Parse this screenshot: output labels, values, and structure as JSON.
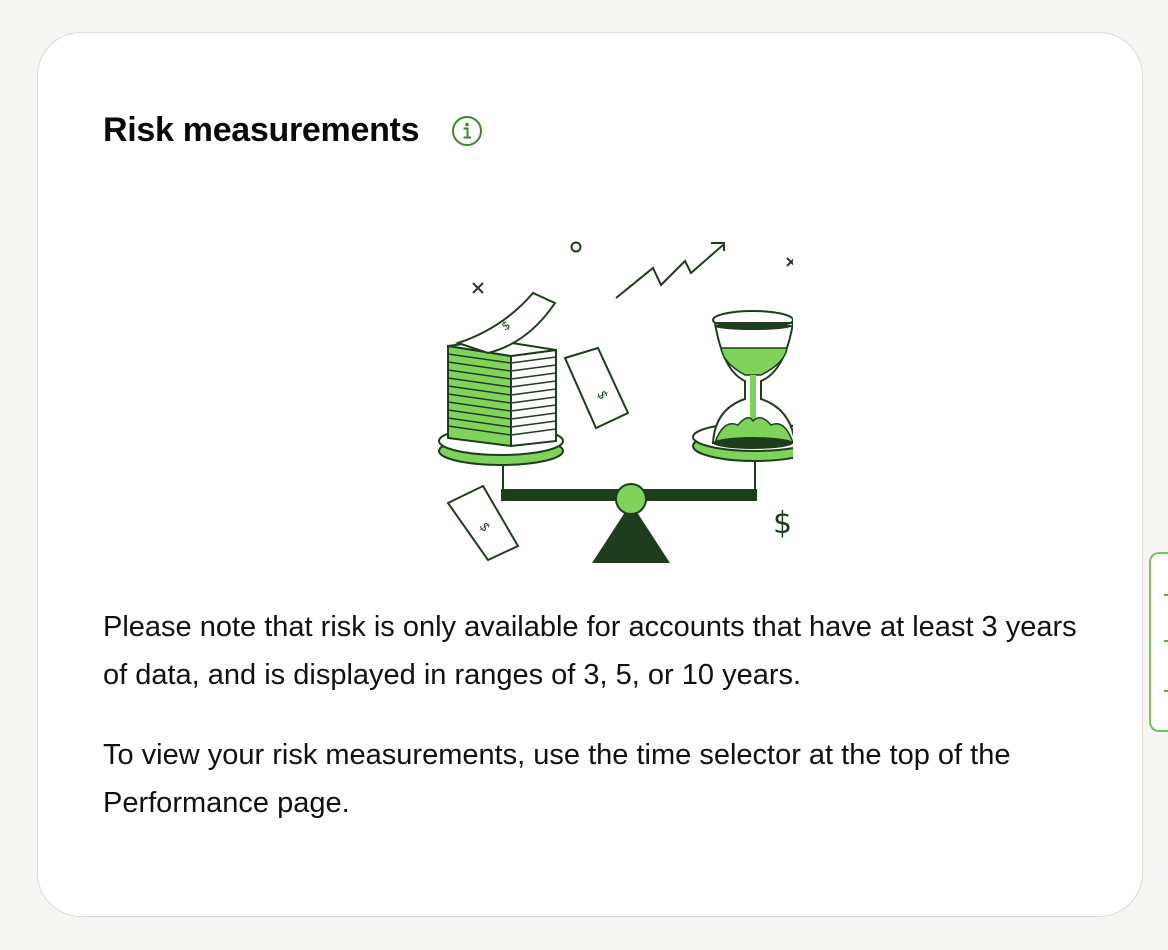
{
  "card": {
    "title": "Risk measurements",
    "info_icon": "info-circle-icon",
    "illustration": "balance-scale-money-hourglass-illustration",
    "paragraph1": "Please note that risk is only available for accounts that have at least 3 years of data, and is displayed in ranges of 3, 5, or 10 years.",
    "paragraph2": "To view your risk measurements, use the time selector at the top of the Performance page."
  },
  "side_tab": {
    "icon": "feedback-tab-icon"
  },
  "colors": {
    "accent_green": "#3a8a2c",
    "light_green": "#7fd35a",
    "dark_green": "#1d3d1c",
    "card_border": "#dedbd5",
    "background": "#f5f5f3"
  }
}
